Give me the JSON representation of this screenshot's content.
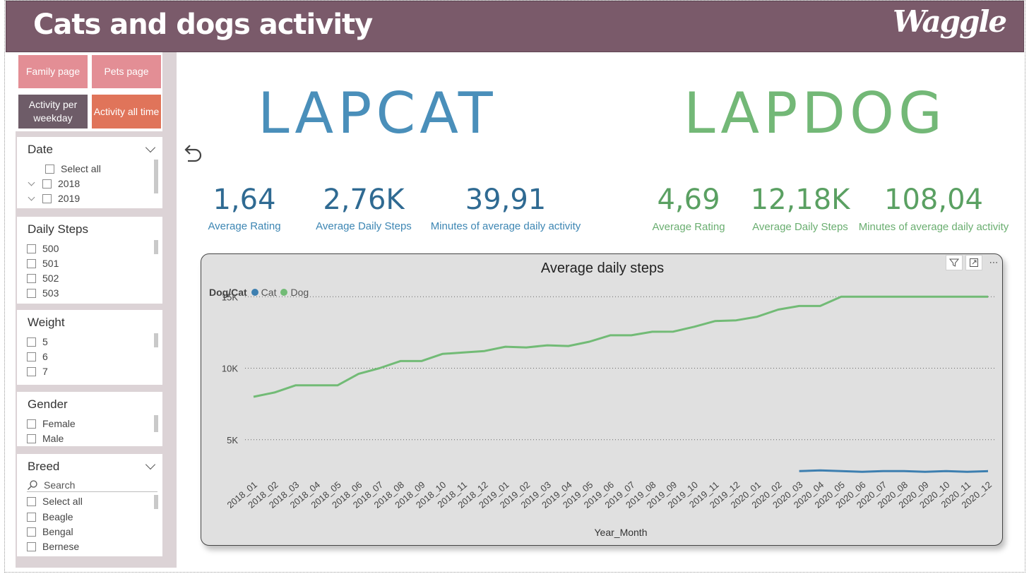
{
  "header": {
    "title": "Cats and dogs activity",
    "logo_text": "Waggle"
  },
  "nav": {
    "family": "Family page",
    "pets": "Pets page",
    "weekday": "Activity per weekday",
    "alltime": "Activity all time"
  },
  "slicers": {
    "date": {
      "title": "Date",
      "select_all": "Select all",
      "items": [
        "2018",
        "2019"
      ]
    },
    "daily_steps": {
      "title": "Daily Steps",
      "items": [
        "500",
        "501",
        "502",
        "503"
      ]
    },
    "weight": {
      "title": "Weight",
      "items": [
        "5",
        "6",
        "7"
      ]
    },
    "gender": {
      "title": "Gender",
      "items": [
        "Female",
        "Male"
      ]
    },
    "breed": {
      "title": "Breed",
      "search_placeholder": "Search",
      "select_all": "Select all",
      "items": [
        "Beagle",
        "Bengal",
        "Bernese"
      ]
    }
  },
  "brands": {
    "cat": "LAPCAT",
    "dog": "LAPDOG"
  },
  "kpis": {
    "cat": [
      {
        "value": "1,64",
        "label": "Average Rating"
      },
      {
        "value": "2,76K",
        "label": "Average Daily Steps"
      },
      {
        "value": "39,91",
        "label": "Minutes of average daily activity"
      }
    ],
    "dog": [
      {
        "value": "4,69",
        "label": "Average Rating"
      },
      {
        "value": "12,18K",
        "label": "Average Daily Steps"
      },
      {
        "value": "108,04",
        "label": "Minutes of average daily activity"
      }
    ]
  },
  "colors": {
    "header": "#7a5a6a",
    "cat": "#3d7fb0",
    "dog": "#72bb76",
    "nav_pink": "#e38e95",
    "nav_dark": "#6e5c68",
    "nav_orange": "#e0745a"
  },
  "chart_data": {
    "type": "line",
    "title": "Average daily steps",
    "legend_title": "Dog/Cat",
    "xlabel": "Year_Month",
    "ylabel": "",
    "ylim": [
      0,
      16000
    ],
    "yticks": [
      "5K",
      "10K",
      "15K"
    ],
    "ytick_values": [
      5000,
      10000,
      15000
    ],
    "grid": true,
    "legend_position": "top-left",
    "categories": [
      "2018_01",
      "2018_02",
      "2018_03",
      "2018_04",
      "2018_05",
      "2018_06",
      "2018_07",
      "2018_08",
      "2018_09",
      "2018_10",
      "2018_11",
      "2018_12",
      "2019_01",
      "2019_02",
      "2019_03",
      "2019_04",
      "2019_05",
      "2019_06",
      "2019_07",
      "2019_08",
      "2019_09",
      "2019_10",
      "2019_11",
      "2019_12",
      "2020_01",
      "2020_02",
      "2020_03",
      "2020_04",
      "2020_05",
      "2020_06",
      "2020_07",
      "2020_08",
      "2020_09",
      "2020_10",
      "2020_11",
      "2020_12"
    ],
    "series": [
      {
        "name": "Cat",
        "color": "#3d7fb0",
        "values": [
          null,
          null,
          null,
          null,
          null,
          null,
          null,
          null,
          null,
          null,
          null,
          null,
          null,
          null,
          null,
          null,
          null,
          null,
          null,
          null,
          null,
          null,
          null,
          null,
          null,
          null,
          2800,
          2850,
          2800,
          2750,
          2800,
          2800,
          2750,
          2800,
          2750,
          2800
        ]
      },
      {
        "name": "Dog",
        "color": "#72bb76",
        "values": [
          8000,
          8300,
          8800,
          8800,
          8800,
          9600,
          10000,
          10500,
          10500,
          11000,
          11100,
          11200,
          11500,
          11450,
          11600,
          11550,
          11850,
          12300,
          12300,
          12550,
          12560,
          12900,
          13300,
          13350,
          13600,
          14100,
          14350,
          14350,
          15000,
          15000,
          15000,
          15000,
          15000,
          15000,
          15000,
          15000
        ]
      }
    ]
  }
}
